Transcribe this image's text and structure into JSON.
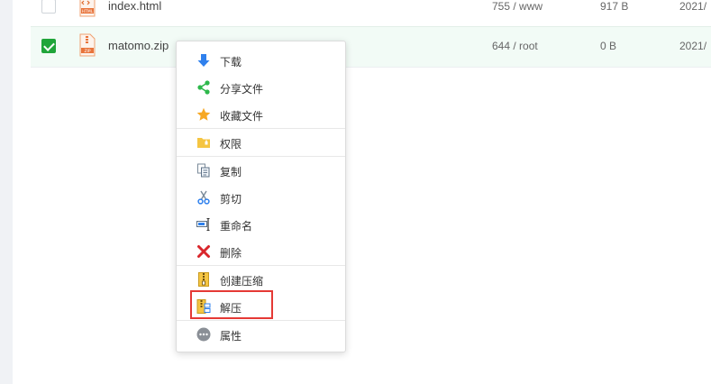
{
  "files": [
    {
      "name": "index.html",
      "perm": "755 / www",
      "size": "917 B",
      "date": "2021/",
      "checked": false,
      "icon": "html-file-icon",
      "icon_text": "HTML"
    },
    {
      "name": "matomo.zip",
      "perm": "644 / root",
      "size": "0 B",
      "date": "2021/",
      "checked": true,
      "icon": "zip-file-icon",
      "icon_text": "ZIP"
    }
  ],
  "context_menu": {
    "items": [
      {
        "label": "下载",
        "icon": "download-arrow-icon"
      },
      {
        "label": "分享文件",
        "icon": "share-icon"
      },
      {
        "label": "收藏文件",
        "icon": "star-icon"
      },
      {
        "label": "权限",
        "icon": "folder-lock-icon"
      },
      {
        "label": "复制",
        "icon": "copy-icon"
      },
      {
        "label": "剪切",
        "icon": "scissors-icon"
      },
      {
        "label": "重命名",
        "icon": "rename-icon"
      },
      {
        "label": "删除",
        "icon": "delete-x-icon"
      },
      {
        "label": "创建压缩",
        "icon": "compress-icon"
      },
      {
        "label": "解压",
        "icon": "extract-icon"
      },
      {
        "label": "属性",
        "icon": "properties-icon"
      }
    ],
    "highlighted": "解压"
  },
  "colors": {
    "accent_green": "#20a53a",
    "highlight_red": "#e53935",
    "selected_row": "#f2fbf6"
  }
}
